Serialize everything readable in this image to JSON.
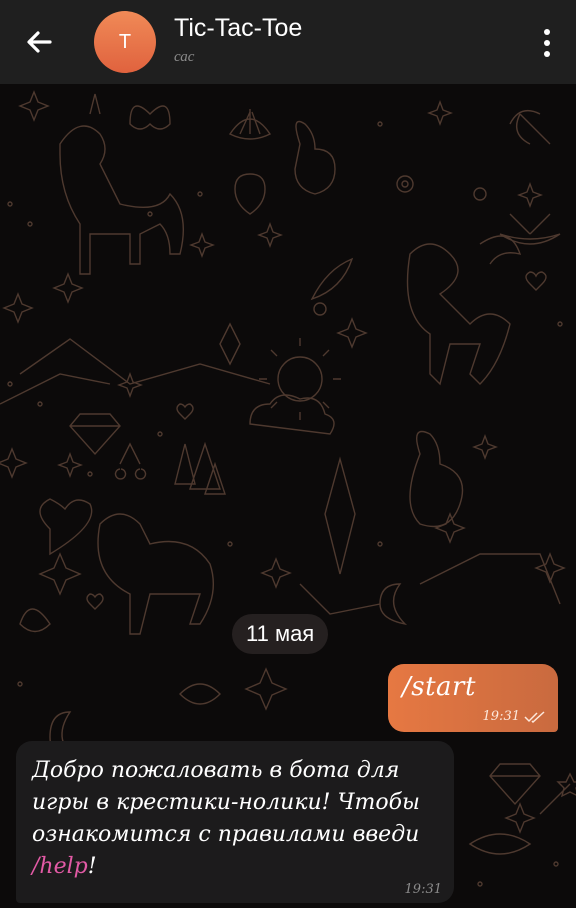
{
  "header": {
    "back_icon": "arrow-left-icon",
    "avatar_letter": "T",
    "title": "Tic-Tac-Toe",
    "subtitle": "сас",
    "menu_icon": "more-vertical-icon",
    "avatar_color": "#e86f47"
  },
  "chat": {
    "date_separator": "11 мая",
    "messages": [
      {
        "direction": "out",
        "text": "/start",
        "time": "19:31",
        "status_icon": "double-check-icon"
      },
      {
        "direction": "in",
        "text_prefix": "Добро пожаловать в бота для игры в крестики-нолики! Чтобы ознакомится с правилами введи ",
        "command": "/help",
        "text_suffix": "!",
        "time": "19:31"
      }
    ]
  },
  "colors": {
    "header_bg": "#1f1f1f",
    "chat_bg": "#0c0a0a",
    "outgoing_bubble": "#e07545",
    "incoming_bubble": "#1c1b1c",
    "command_link": "#e25aa5",
    "pattern": "#5a4236"
  }
}
